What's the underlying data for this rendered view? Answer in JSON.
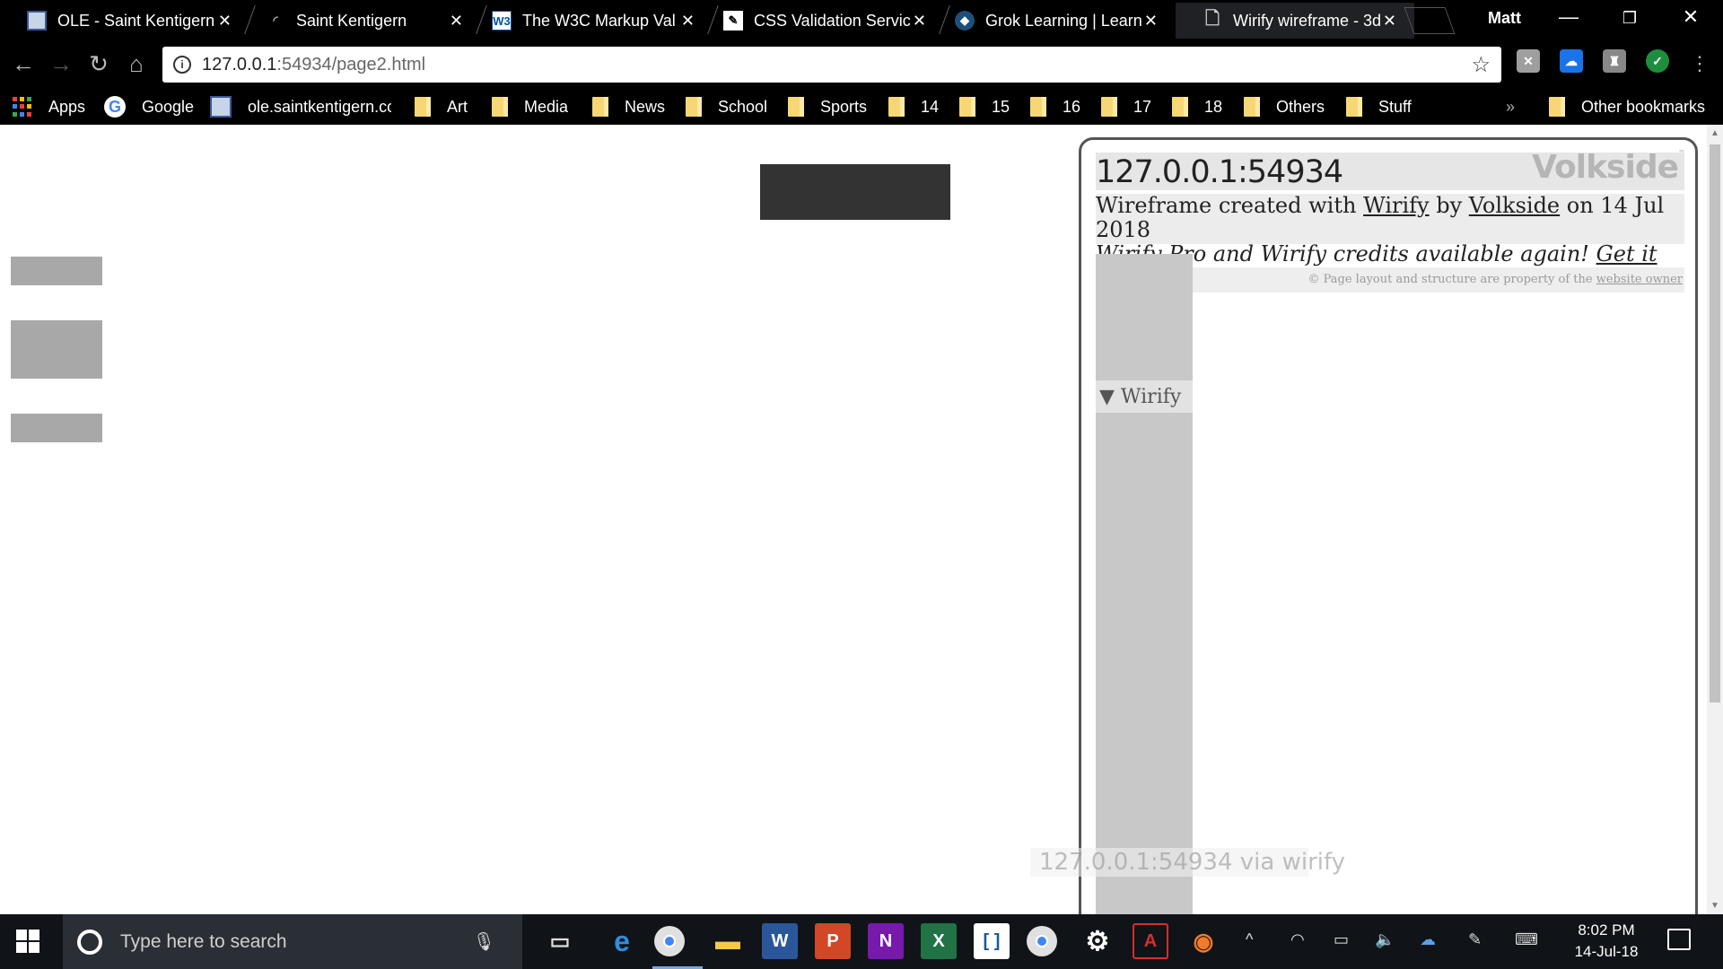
{
  "tabs": [
    {
      "title": "OLE - Saint Kentigern",
      "icon": "ole-favicon"
    },
    {
      "title": "Saint Kentigern",
      "icon": "loading-spinner"
    },
    {
      "title": "The W3C Markup Val",
      "icon": "w3c-favicon"
    },
    {
      "title": "CSS Validation Servic",
      "icon": "css-favicon"
    },
    {
      "title": "Grok Learning | Learn",
      "icon": "grok-favicon"
    },
    {
      "title": "Wirify wireframe - 3d",
      "icon": "page-favicon"
    }
  ],
  "profile": {
    "name": "Matt"
  },
  "address_bar": {
    "host": "127.0.0.1",
    "rest": ":54934/page2.html"
  },
  "bookmarks": [
    {
      "label": "Apps",
      "icon": "apps-icon"
    },
    {
      "label": "Google",
      "icon": "google-icon"
    },
    {
      "label": "ole.saintkentigern.co",
      "icon": "ole-icon"
    },
    {
      "label": "Art",
      "icon": "folder-icon"
    },
    {
      "label": "Media",
      "icon": "folder-icon"
    },
    {
      "label": "News",
      "icon": "folder-icon"
    },
    {
      "label": "School",
      "icon": "folder-icon"
    },
    {
      "label": "Sports",
      "icon": "folder-icon"
    },
    {
      "label": "14",
      "icon": "folder-icon"
    },
    {
      "label": "15",
      "icon": "folder-icon"
    },
    {
      "label": "16",
      "icon": "folder-icon"
    },
    {
      "label": "17",
      "icon": "folder-icon"
    },
    {
      "label": "18",
      "icon": "folder-icon"
    },
    {
      "label": "Others",
      "icon": "folder-icon"
    },
    {
      "label": "Stuff",
      "icon": "folder-icon"
    }
  ],
  "bookmarks_overflow": "»",
  "other_bookmarks": "Other bookmarks",
  "wirify": {
    "host": "127.0.0.1:54934",
    "logo": "Volkside",
    "logo_tm": "™",
    "created_prefix": "Wireframe created with ",
    "wirify_link": "Wirify",
    "by_text": " by ",
    "volkside_link": "Volkside",
    "date_text": " on 14 Jul 2018",
    "pro_text": "Wirify Pro and Wirify credits available again! ",
    "get_it_link": "Get it now",
    "copyright_prefix": "©  Page layout and structure are property of the ",
    "website_owner_link": "website owner",
    "toggle_label": "▼ Wirify",
    "watermark": "127.0.0.1:54934 via wirify"
  },
  "taskbar": {
    "search_placeholder": "Type here to search",
    "time": "8:02 PM",
    "date": "14-Jul-18"
  },
  "colors": {
    "chrome_dark": "#000000",
    "page_bg": "#ffffff",
    "dark_block": "#333333",
    "grey_block": "#a8a8a8",
    "wirify_sidebar": "#c8c8c8",
    "taskbar": "#101418"
  }
}
